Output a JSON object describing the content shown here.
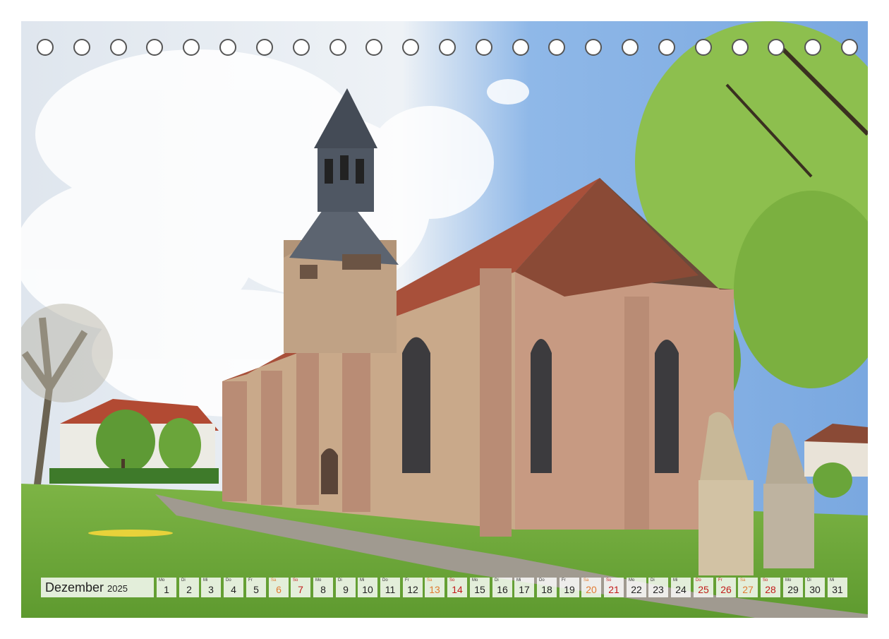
{
  "calendar": {
    "month": "Dezember",
    "year": "2025",
    "days": [
      {
        "wd": "Mo",
        "num": "1",
        "kind": "normal"
      },
      {
        "wd": "Di",
        "num": "2",
        "kind": "normal"
      },
      {
        "wd": "Mi",
        "num": "3",
        "kind": "normal"
      },
      {
        "wd": "Do",
        "num": "4",
        "kind": "normal"
      },
      {
        "wd": "Fr",
        "num": "5",
        "kind": "normal"
      },
      {
        "wd": "Sa",
        "num": "6",
        "kind": "sat"
      },
      {
        "wd": "So",
        "num": "7",
        "kind": "red"
      },
      {
        "wd": "Mo",
        "num": "8",
        "kind": "normal"
      },
      {
        "wd": "Di",
        "num": "9",
        "kind": "normal"
      },
      {
        "wd": "Mi",
        "num": "10",
        "kind": "normal"
      },
      {
        "wd": "Do",
        "num": "11",
        "kind": "normal"
      },
      {
        "wd": "Fr",
        "num": "12",
        "kind": "normal"
      },
      {
        "wd": "Sa",
        "num": "13",
        "kind": "sat"
      },
      {
        "wd": "So",
        "num": "14",
        "kind": "red"
      },
      {
        "wd": "Mo",
        "num": "15",
        "kind": "normal"
      },
      {
        "wd": "Di",
        "num": "16",
        "kind": "normal"
      },
      {
        "wd": "Mi",
        "num": "17",
        "kind": "normal"
      },
      {
        "wd": "Do",
        "num": "18",
        "kind": "normal"
      },
      {
        "wd": "Fr",
        "num": "19",
        "kind": "normal"
      },
      {
        "wd": "Sa",
        "num": "20",
        "kind": "sat"
      },
      {
        "wd": "So",
        "num": "21",
        "kind": "red"
      },
      {
        "wd": "Mo",
        "num": "22",
        "kind": "normal"
      },
      {
        "wd": "Di",
        "num": "23",
        "kind": "normal"
      },
      {
        "wd": "Mi",
        "num": "24",
        "kind": "normal"
      },
      {
        "wd": "Do",
        "num": "25",
        "kind": "red"
      },
      {
        "wd": "Fr",
        "num": "26",
        "kind": "red"
      },
      {
        "wd": "Sa",
        "num": "27",
        "kind": "sat"
      },
      {
        "wd": "So",
        "num": "28",
        "kind": "red"
      },
      {
        "wd": "Mo",
        "num": "29",
        "kind": "normal"
      },
      {
        "wd": "Di",
        "num": "30",
        "kind": "normal"
      },
      {
        "wd": "Mi",
        "num": "31",
        "kind": "normal"
      }
    ]
  },
  "binding": {
    "hole_count": 23
  },
  "colors": {
    "saturday": "#e07b32",
    "holiday": "#c21b1b",
    "sky": "#8fb8e8",
    "grass": "#6fa63a",
    "sandstone": "#c9a98a",
    "roof": "#a8503a"
  }
}
